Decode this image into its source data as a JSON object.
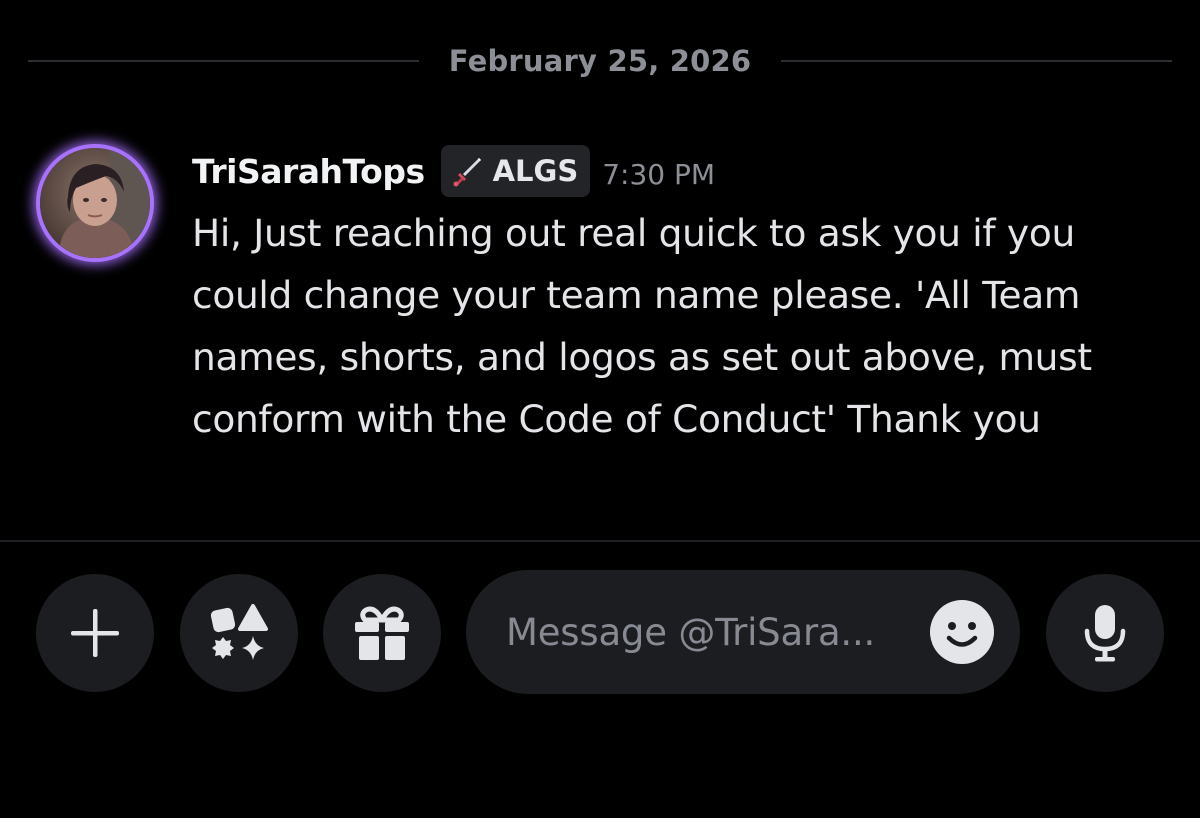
{
  "date_divider": {
    "text": "February 25, 2026"
  },
  "message": {
    "author": "TriSarahTops",
    "tag": {
      "icon": "sword-icon",
      "label": "ALGS"
    },
    "time": "7:30 PM",
    "body": "Hi, Just reaching out real quick to ask you if you could change your team name please. 'All Team names, shorts, and logos as set out above, must conform with the Code of Conduct' Thank you"
  },
  "composer": {
    "add_icon": "plus-icon",
    "apps_icon": "apps-icon",
    "gift_icon": "gift-icon",
    "placeholder": "Message @TriSara...",
    "emoji_icon": "smiley-icon",
    "mic_icon": "microphone-icon"
  },
  "colors": {
    "background": "#000000",
    "avatar_ring": "#a872ff",
    "button_bg": "#1c1d21",
    "muted_text": "#8c8f96"
  }
}
